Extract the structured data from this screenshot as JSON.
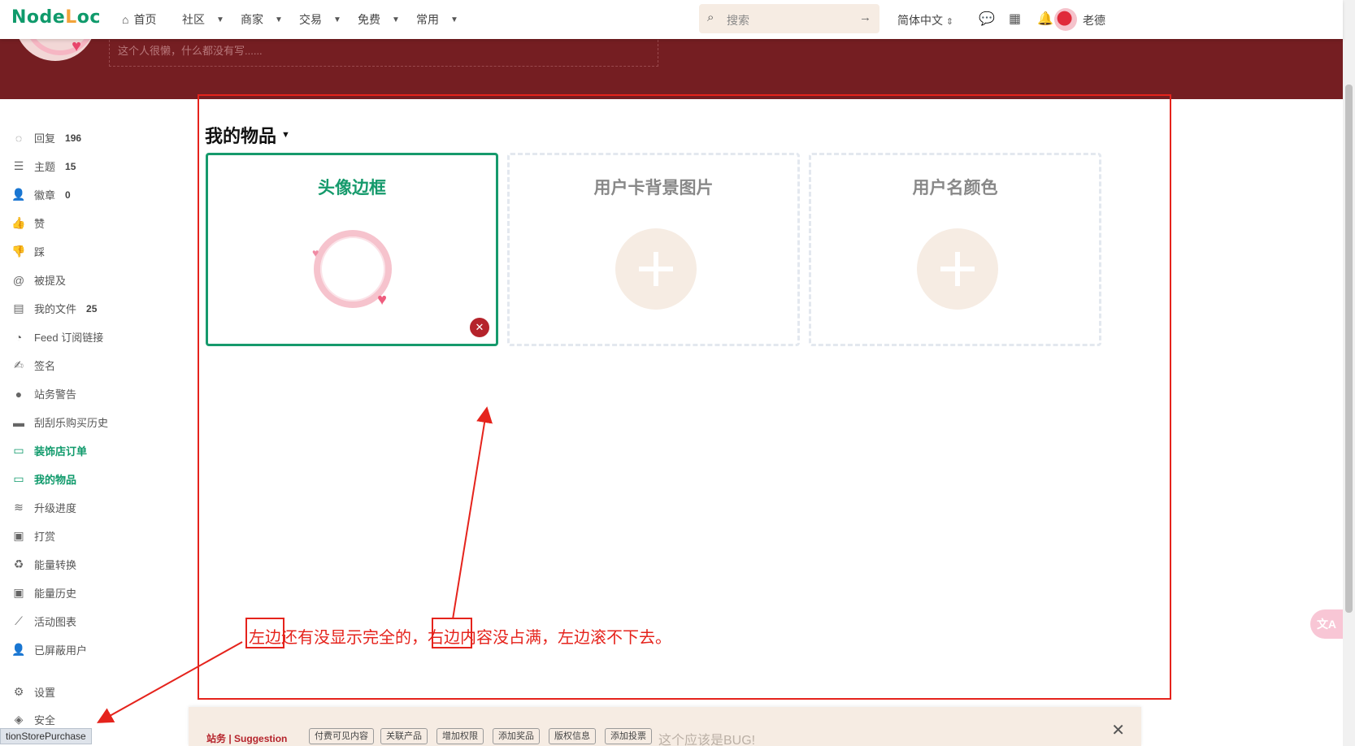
{
  "brand": {
    "logo": "NodeLoc",
    "accent": "#0f9a6b",
    "banner_color": "#751e22"
  },
  "nav": {
    "home": "首页",
    "items": [
      "社区",
      "商家",
      "交易",
      "免费",
      "常用"
    ],
    "search_placeholder": "搜索",
    "language": "简体中文",
    "user_name": "老德"
  },
  "profile": {
    "bio": "这个人很懒，什么都没有写......"
  },
  "sidebar": {
    "items": [
      {
        "label": "回复",
        "count": "196",
        "icon": "comment-icon"
      },
      {
        "label": "主题",
        "count": "15",
        "icon": "list-icon"
      },
      {
        "label": "徽章",
        "count": "0",
        "icon": "user-badge-icon"
      },
      {
        "label": "赞",
        "count": "",
        "icon": "thumbs-up-icon"
      },
      {
        "label": "踩",
        "count": "",
        "icon": "thumbs-down-icon"
      },
      {
        "label": "被提及",
        "count": "",
        "icon": "at-icon"
      },
      {
        "label": "我的文件",
        "count": "25",
        "icon": "file-icon"
      },
      {
        "label": "Feed 订阅链接",
        "count": "",
        "icon": "rss-icon"
      },
      {
        "label": "签名",
        "count": "",
        "icon": "signature-icon"
      },
      {
        "label": "站务警告",
        "count": "",
        "icon": "warning-icon"
      },
      {
        "label": "刮刮乐购买历史",
        "count": "",
        "icon": "ticket-icon"
      },
      {
        "label": "装饰店订单",
        "count": "",
        "icon": "store-icon",
        "active": true
      },
      {
        "label": "我的物品",
        "count": "",
        "icon": "store-icon",
        "active": true
      },
      {
        "label": "升级进度",
        "count": "",
        "icon": "layers-icon"
      },
      {
        "label": "打赏",
        "count": "",
        "icon": "money-icon"
      },
      {
        "label": "能量转换",
        "count": "",
        "icon": "recycle-icon"
      },
      {
        "label": "能量历史",
        "count": "",
        "icon": "money-icon"
      },
      {
        "label": "活动图表",
        "count": "",
        "icon": "chart-line-icon"
      },
      {
        "label": "已屏蔽用户",
        "count": "",
        "icon": "user-block-icon"
      },
      {
        "label": "设置",
        "count": "",
        "icon": "gear-icon"
      },
      {
        "label": "安全",
        "count": "",
        "icon": "shield-icon"
      }
    ]
  },
  "main": {
    "title": "我的物品",
    "cards": [
      {
        "title": "头像边框",
        "state": "selected"
      },
      {
        "title": "用户卡背景图片",
        "state": "empty"
      },
      {
        "title": "用户名颜色",
        "state": "empty"
      }
    ]
  },
  "annotation": {
    "text": "左边还有没显示完全的，右边内容没占满，左边滚不下去。",
    "color": "#e5231c"
  },
  "suggestion": {
    "tag": "站务 | Suggestion",
    "buttons": [
      "付费可见内容",
      "关联产品",
      "增加权限",
      "添加奖品",
      "版权信息",
      "添加投票"
    ],
    "input_text": "这个应该是BUG!"
  },
  "status_link": "tionStorePurchase",
  "translate_label": "文A"
}
